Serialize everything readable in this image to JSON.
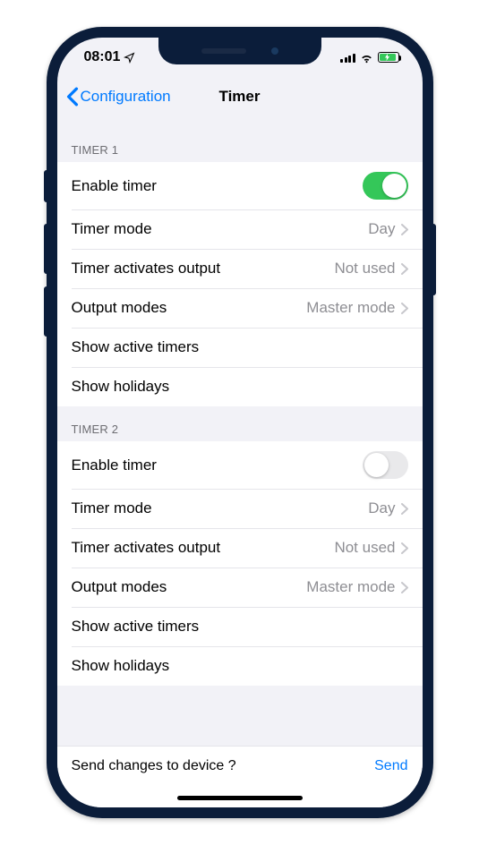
{
  "status": {
    "time": "08:01"
  },
  "nav": {
    "back_label": "Configuration",
    "title": "Timer"
  },
  "sections": [
    {
      "header": "TIMER 1",
      "enable": {
        "label": "Enable timer",
        "on": true
      },
      "rows": {
        "mode": {
          "label": "Timer mode",
          "value": "Day"
        },
        "output": {
          "label": "Timer activates output",
          "value": "Not used"
        },
        "modes": {
          "label": "Output modes",
          "value": "Master mode"
        },
        "active": {
          "label": "Show active timers"
        },
        "holidays": {
          "label": "Show holidays"
        }
      }
    },
    {
      "header": "TIMER 2",
      "enable": {
        "label": "Enable timer",
        "on": false
      },
      "rows": {
        "mode": {
          "label": "Timer mode",
          "value": "Day"
        },
        "output": {
          "label": "Timer activates output",
          "value": "Not used"
        },
        "modes": {
          "label": "Output modes",
          "value": "Master mode"
        },
        "active": {
          "label": "Show active timers"
        },
        "holidays": {
          "label": "Show holidays"
        }
      }
    }
  ],
  "footer": {
    "prompt": "Send changes to device ?",
    "action": "Send"
  }
}
